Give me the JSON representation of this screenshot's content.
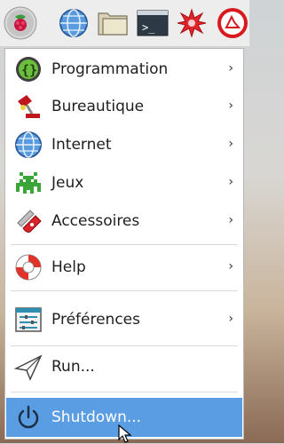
{
  "taskbar": {
    "icons": [
      "raspberry-menu-icon",
      "web-browser-icon",
      "file-manager-icon",
      "terminal-icon",
      "mathematica-icon",
      "wolfram-icon"
    ]
  },
  "menu": {
    "items": [
      {
        "label": "Programmation",
        "icon": "programming-icon",
        "has_submenu": true
      },
      {
        "label": "Bureautique",
        "icon": "office-lamp-icon",
        "has_submenu": true
      },
      {
        "label": "Internet",
        "icon": "globe-icon",
        "has_submenu": true
      },
      {
        "label": "Jeux",
        "icon": "games-invader-icon",
        "has_submenu": true
      },
      {
        "label": "Accessoires",
        "icon": "pocket-knife-icon",
        "has_submenu": true
      },
      {
        "label": "Help",
        "icon": "lifebuoy-icon",
        "has_submenu": true
      },
      {
        "label": "Préférences",
        "icon": "preferences-icon",
        "has_submenu": true
      },
      {
        "label": "Run...",
        "icon": "paper-plane-icon",
        "has_submenu": false
      },
      {
        "label": "Shutdown...",
        "icon": "power-icon",
        "has_submenu": false,
        "highlighted": true
      }
    ],
    "chevron": "›"
  },
  "colors": {
    "highlight": "#5a9de3",
    "taskbar": "#ededed"
  }
}
